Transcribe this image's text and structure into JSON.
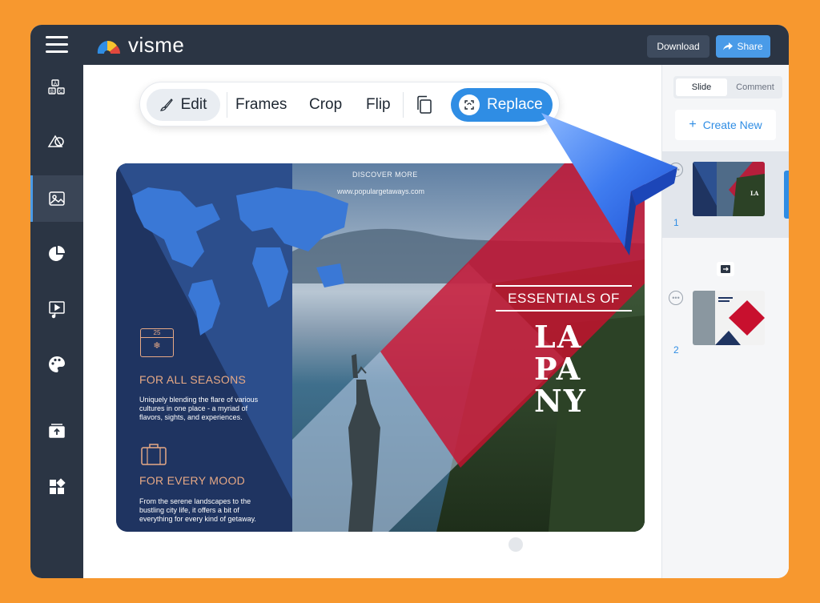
{
  "app": {
    "logo_text": "visme"
  },
  "topbar": {
    "download_label": "Download",
    "share_label": "Share"
  },
  "left_tools": [
    {
      "name": "text-blocks-icon"
    },
    {
      "name": "shapes-icon"
    },
    {
      "name": "images-icon",
      "active": true
    },
    {
      "name": "charts-icon"
    },
    {
      "name": "media-icon"
    },
    {
      "name": "colors-icon"
    },
    {
      "name": "uploads-icon"
    },
    {
      "name": "apps-icon"
    }
  ],
  "toolbar": {
    "edit_label": "Edit",
    "frames_label": "Frames",
    "crop_label": "Crop",
    "flip_label": "Flip",
    "replace_label": "Replace"
  },
  "slide": {
    "discover": "DISCOVER MORE",
    "url": "www.populargetaways.com",
    "heading1": "FOR ALL SEASONS",
    "body1": "Uniquely blending the flare of various cultures in one place - a myriad of flavors, sights, and experiences.",
    "heading2": "FOR EVERY MOOD",
    "body2": "From the serene landscapes to the bustling city life, it offers a bit of everything for every kind of getaway.",
    "essentials": "ESSENTIALS OF",
    "big_line1": "LA",
    "big_line2": "PA",
    "big_line3": "NY",
    "calendar_number": "25"
  },
  "right_panel": {
    "tab_slide": "Slide",
    "tab_comment": "Comment",
    "create_new": "Create New",
    "slide_numbers": [
      "1",
      "2"
    ]
  },
  "colors": {
    "background": "#f7982f",
    "sidebar": "#2b3544",
    "accent": "#2f8de4",
    "slide_navy": "#1f3461",
    "slide_red": "#c8102e"
  }
}
